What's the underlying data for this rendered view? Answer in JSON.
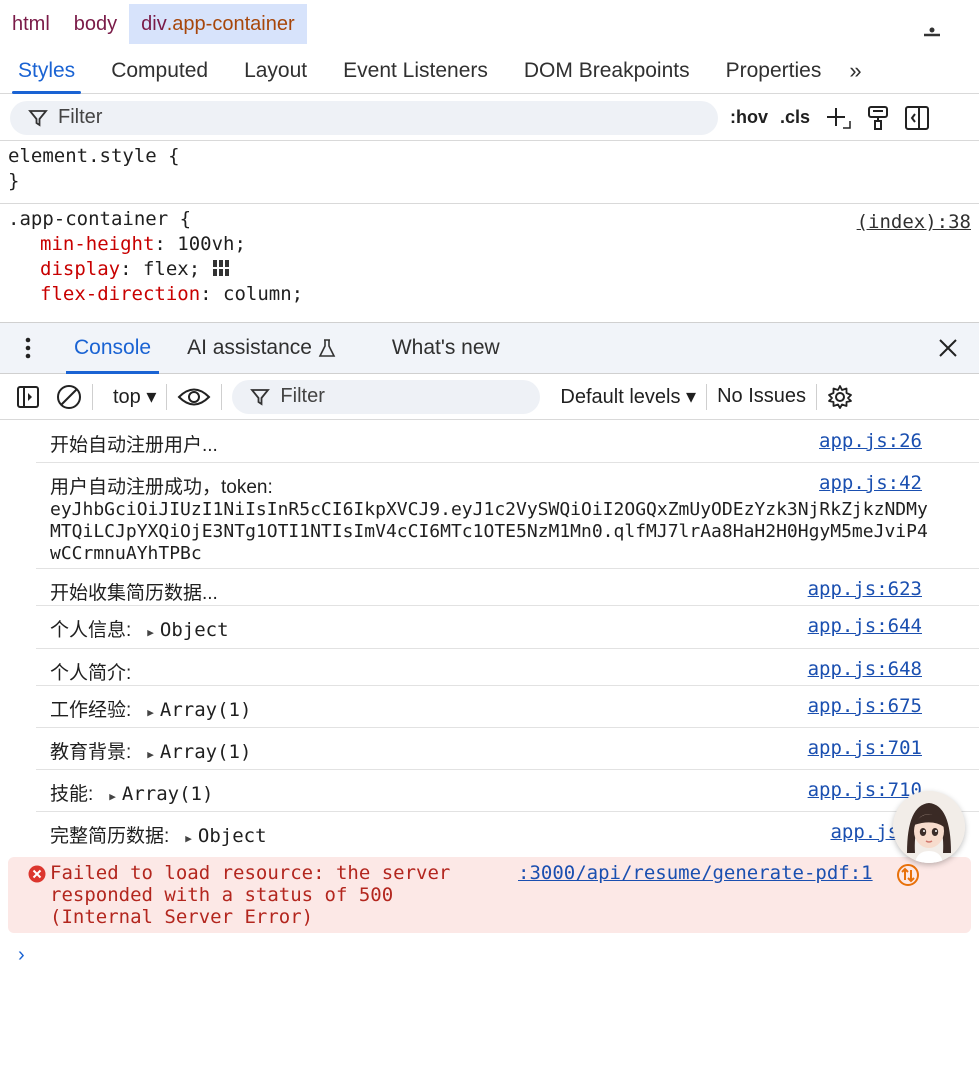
{
  "breadcrumb": {
    "items": [
      "html",
      "body"
    ],
    "active_tag": "div",
    "active_class": ".app-container"
  },
  "styles_tabs": [
    "Styles",
    "Computed",
    "Layout",
    "Event Listeners",
    "DOM Breakpoints",
    "Properties"
  ],
  "styles_tabs_more": "»",
  "styles_filter": {
    "placeholder": "Filter",
    "hov": ":hov",
    "cls": ".cls"
  },
  "rules": {
    "element_style_open": "element.style {",
    "element_style_close": "}",
    "app_selector": ".app-container {",
    "app_source": "(index):38",
    "props": [
      {
        "name": "min-height",
        "value": "100vh;"
      },
      {
        "name": "display",
        "value": "flex;"
      },
      {
        "name": "flex-direction",
        "value": "column;"
      }
    ]
  },
  "drawer": {
    "tabs": [
      "Console",
      "AI assistance",
      "What's new"
    ],
    "active": "Console"
  },
  "console_toolbar": {
    "context": "top",
    "filter_placeholder": "Filter",
    "levels": "Default levels",
    "issues": "No Issues"
  },
  "messages": [
    {
      "text": "开始自动注册用户...",
      "source": "app.js:26"
    },
    {
      "text": "用户自动注册成功，token:",
      "token": "eyJhbGciOiJIUzI1NiIsInR5cCI6IkpXVCJ9.eyJ1c2VySWQiOiI2OGQxZmUyODEzYzk3NjRkZjkzNDMyMTQiLCJpYXQiOjE3NTg1OTI1NTIsImV4cCI6MTc1OTE5NzM1Mn0.qlfMJ7lrAa8HaH2H0HgyM5meJviP4wCCrmnuAYhTPBc",
      "source": "app.js:42"
    },
    {
      "text": "开始收集简历数据...",
      "source": "app.js:623"
    },
    {
      "text": "个人信息:",
      "obj": "Object",
      "source": "app.js:644"
    },
    {
      "text": "个人简介:",
      "source": "app.js:648"
    },
    {
      "text": "工作经验:",
      "obj": "Array(1)",
      "source": "app.js:675"
    },
    {
      "text": "教育背景:",
      "obj": "Array(1)",
      "source": "app.js:701"
    },
    {
      "text": "技能:",
      "obj": "Array(1)",
      "source": "app.js:710"
    },
    {
      "text": "完整简历数据:",
      "obj": "Object",
      "source": "app.js:7"
    }
  ],
  "error": {
    "text": "Failed to load resource: the server responded with a status of 500 (Internal Server Error)",
    "source": ":3000/api/resume/generate-pdf:1"
  },
  "prompt": "›"
}
